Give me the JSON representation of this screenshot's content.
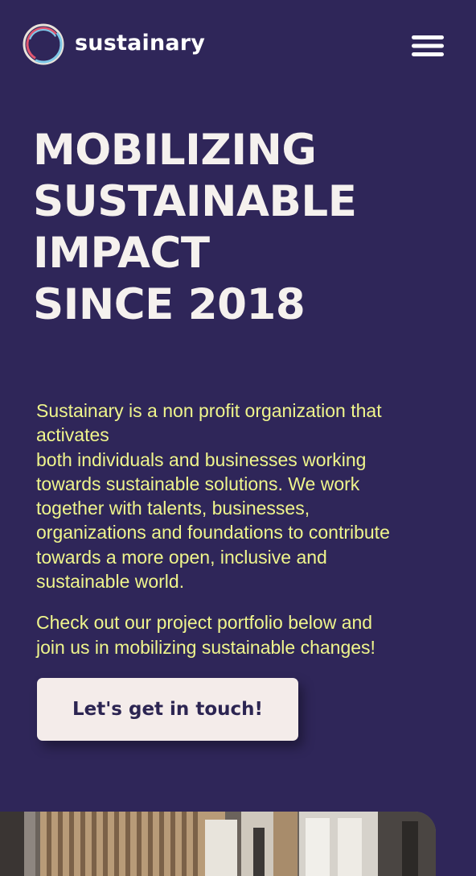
{
  "brand": {
    "name": "sustainary",
    "logo_colors": [
      "#e0566f",
      "#7fc8e8",
      "#e9e3da"
    ]
  },
  "nav": {
    "menu_icon": "hamburger-menu-icon"
  },
  "hero": {
    "title_lines": [
      "MOBILIZING",
      "SUSTAINABLE",
      "IMPACT",
      "SINCE 2018"
    ]
  },
  "intro": {
    "paragraph1_lines": [
      "Sustainary is a non profit organization that",
      "activates",
      "both individuals and businesses working",
      "towards sustainable solutions. We work",
      "together with talents, businesses,",
      "organizations and foundations to contribute",
      "towards a more open, inclusive and",
      "sustainable world."
    ],
    "paragraph2_lines": [
      "Check out our project portfolio below and",
      "join us in mobilizing sustainable changes!"
    ]
  },
  "cta": {
    "label": "Let's get in touch!"
  },
  "colors": {
    "background": "#2f2659",
    "title": "#f5f1ee",
    "body_text": "#eff58c",
    "button_bg": "#f4ecea",
    "button_text": "#2c2552"
  }
}
